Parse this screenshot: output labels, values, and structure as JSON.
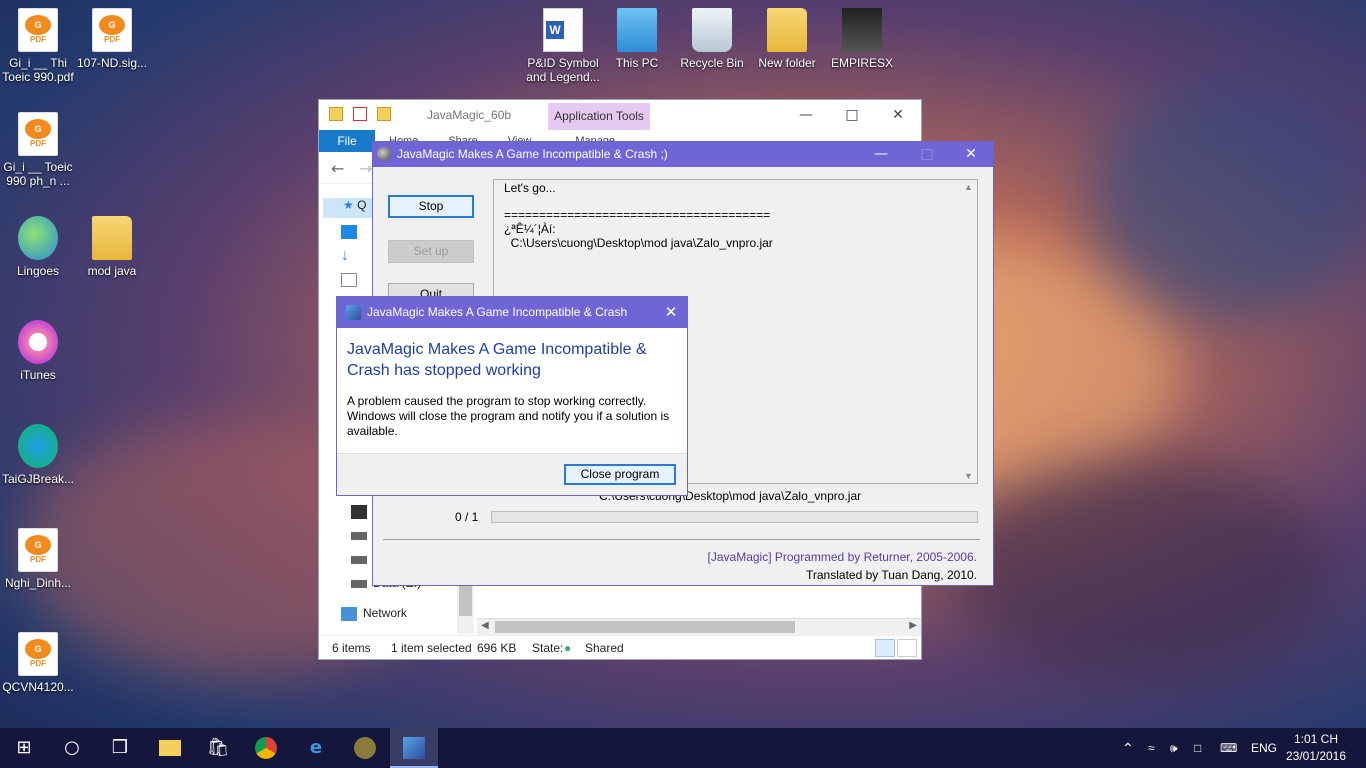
{
  "desktop": {
    "icons": [
      {
        "label": "Gi_i __ Thi Toeic 990.pdf",
        "icon": "pdf-icon"
      },
      {
        "label": "107-ND.sig...",
        "icon": "pdf-icon"
      },
      {
        "label": "Gi_i __ Toeic 990 ph_n ...",
        "icon": "pdf-icon"
      },
      {
        "label": "Lingoes",
        "icon": "lingoes-icon"
      },
      {
        "label": "mod java",
        "icon": "folder-icon"
      },
      {
        "label": "iTunes",
        "icon": "itunes-icon"
      },
      {
        "label": "TaiGJBreak...",
        "icon": "app-icon"
      },
      {
        "label": "Nghi_Dinh...",
        "icon": "pdf-icon"
      },
      {
        "label": "QCVN4120...",
        "icon": "pdf-icon"
      },
      {
        "label": "P&ID Symbol and Legend...",
        "icon": "word-icon"
      },
      {
        "label": "This PC",
        "icon": "computer-icon"
      },
      {
        "label": "Recycle Bin",
        "icon": "recycle-bin-icon"
      },
      {
        "label": "New folder",
        "icon": "folder-icon"
      },
      {
        "label": "EMPIRESX",
        "icon": "app-icon"
      }
    ],
    "pdf_badge": "PDF"
  },
  "explorer": {
    "title": "JavaMagic_60b",
    "app_tools_label": "Application Tools",
    "file_tab": "File",
    "ribbon_tabs": [
      "Home",
      "Share",
      "View",
      "Manage"
    ],
    "sidebar": {
      "quick_access_label": "Q",
      "network_label": "Network",
      "data_label": "Data (E:)"
    },
    "status": {
      "items": "6 items",
      "selected": "1 item selected",
      "size": "696 KB",
      "state_label": "State:",
      "state_value": "Shared"
    }
  },
  "javamagic": {
    "title": "JavaMagic Makes A Game Incompatible & Crash ;)",
    "buttons": {
      "stop": "Stop",
      "setup": "Set up",
      "quit": "Quit"
    },
    "log": [
      "Let's go...",
      "",
      "======================================",
      "¿ªÊ¼´¦Àí:",
      "  C:\\Users\\cuong\\Desktop\\mod java\\Zalo_vnpro.jar"
    ],
    "current_path": "C:\\Users\\cuong\\Desktop\\mod java\\Zalo_vnpro.jar",
    "progress": {
      "label": "0 / 1",
      "current": 0,
      "total": 1
    },
    "credit1": "[JavaMagic] Programmed by Returner, 2005-2006.",
    "credit2": "Translated by Tuan Dang, 2010.",
    "credit1_color": "#5a3d9e"
  },
  "crash_dialog": {
    "title": "JavaMagic Makes A Game Incompatible & Crash",
    "heading": "JavaMagic Makes A Game Incompatible & Crash has stopped working",
    "body": "A problem caused the program to stop working correctly. Windows will close the program and notify you if a solution is available.",
    "button": "Close program"
  },
  "taskbar": {
    "time": "1:01 CH",
    "date": "23/01/2016",
    "language": "ENG"
  }
}
